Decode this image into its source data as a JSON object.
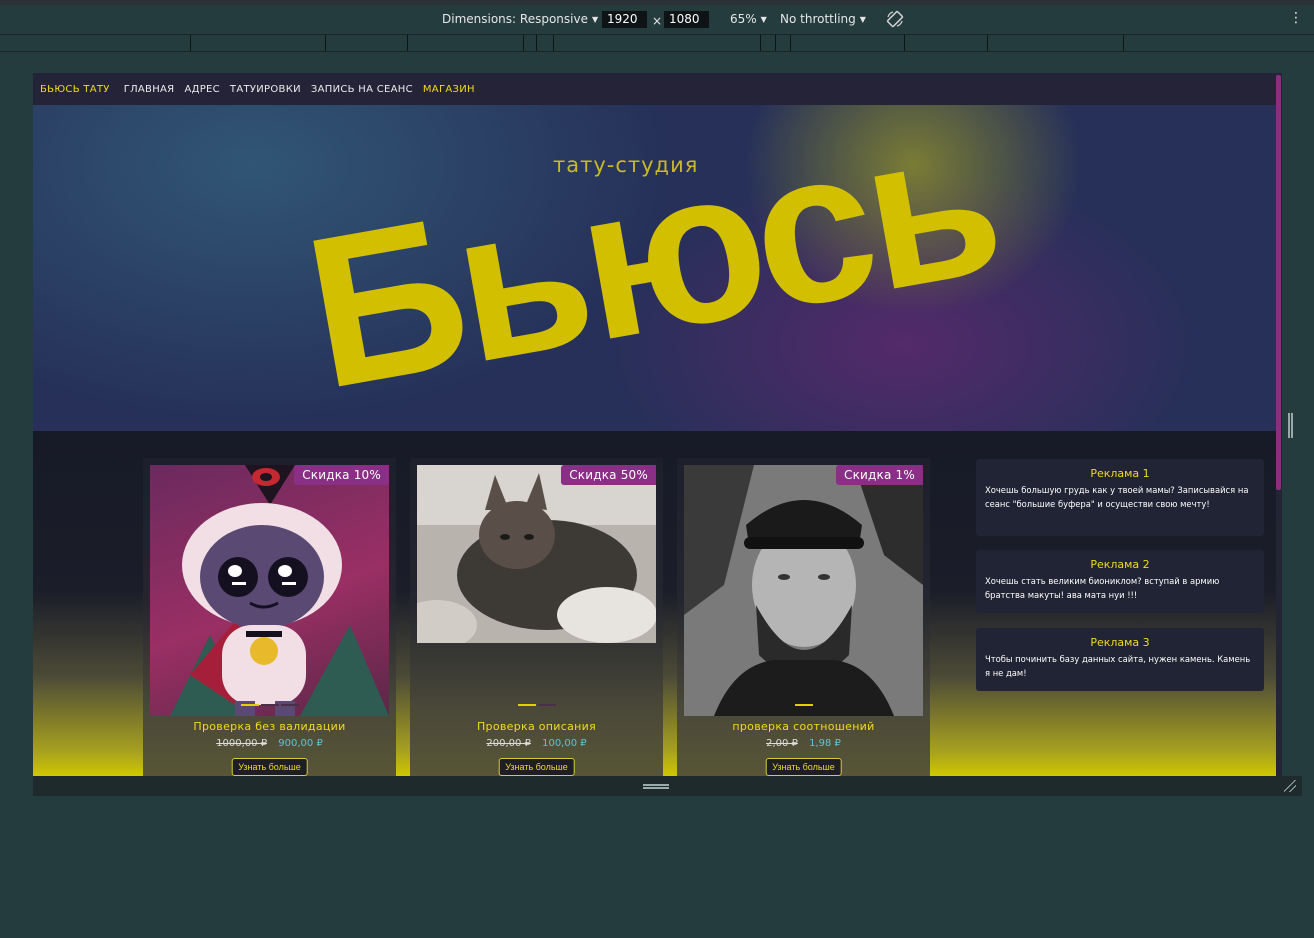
{
  "devtools": {
    "dimensions_label": "Dimensions: Responsive",
    "width_value": "1920",
    "times": "×",
    "height_value": "1080",
    "zoom": "65%",
    "throttling": "No throttling",
    "more": "⋮"
  },
  "site": {
    "brand": "БЬЮСЬ ТАТУ",
    "nav": [
      "ГЛАВНАЯ",
      "АДРЕС",
      "ТАТУИРОВКИ",
      "ЗАПИСЬ НА СЕАНС",
      "МАГАЗИН"
    ],
    "active_nav": "МАГАЗИН",
    "hero_subtitle": "тату-студия",
    "hero_title": "Бьюсь",
    "colors": {
      "accent": "#f2dc1a",
      "badge": "#8a2f86",
      "new_price": "#5bc6d6",
      "page_bg": "#141826"
    }
  },
  "products": [
    {
      "badge": "Скидка 10%",
      "title": "Проверка без валидации",
      "old_price": "1000,00 ₽",
      "new_price": "900,00 ₽",
      "button": "Узнать больше",
      "image": "cartoon-lamb-illustration"
    },
    {
      "badge": "Скидка 50%",
      "title": "Проверка описания",
      "old_price": "200,00 ₽",
      "new_price": "100,00 ₽",
      "button": "Узнать больше",
      "image": "hairless-cat-photo"
    },
    {
      "badge": "Скидка 1%",
      "title": "проверка соотношений",
      "old_price": "2,00 ₽",
      "new_price": "1,98 ₽",
      "button": "Узнать больше",
      "image": "bearded-man-photo"
    }
  ],
  "ads": [
    {
      "title": "Реклама 1",
      "text": "Хочешь большую грудь как у твоей мамы? Записывайся на сеанс \"большие буфера\" и осуществи свою мечту!"
    },
    {
      "title": "Реклама 2",
      "text": "Хочешь стать великим биониклом? вступай в армию братства макуты! ава мата нуи !!!"
    },
    {
      "title": "Реклама 3",
      "text": "Чтобы починить базу данных сайта, нужен камень. Камень я не дам!"
    }
  ]
}
